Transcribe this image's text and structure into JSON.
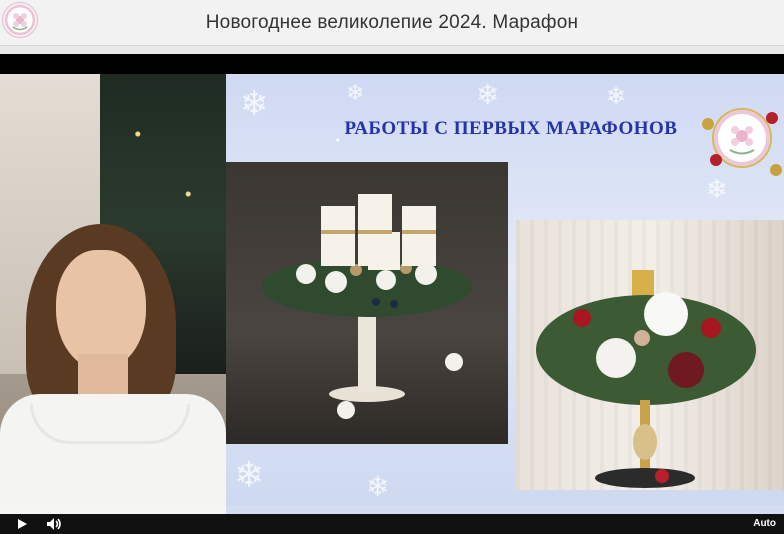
{
  "header": {
    "title": "Новогоднее великолепие 2024. Марафон",
    "logo_icon": "flower-logo-icon"
  },
  "slide": {
    "heading": "РАБОТЫ С ПЕРВЫХ МАРАФОНОВ",
    "heading_color": "#2533a8",
    "logo_icon": "flower-logo-icon"
  },
  "player": {
    "play_icon": "play-icon",
    "volume_icon": "volume-icon",
    "quality_label": "Auto"
  }
}
